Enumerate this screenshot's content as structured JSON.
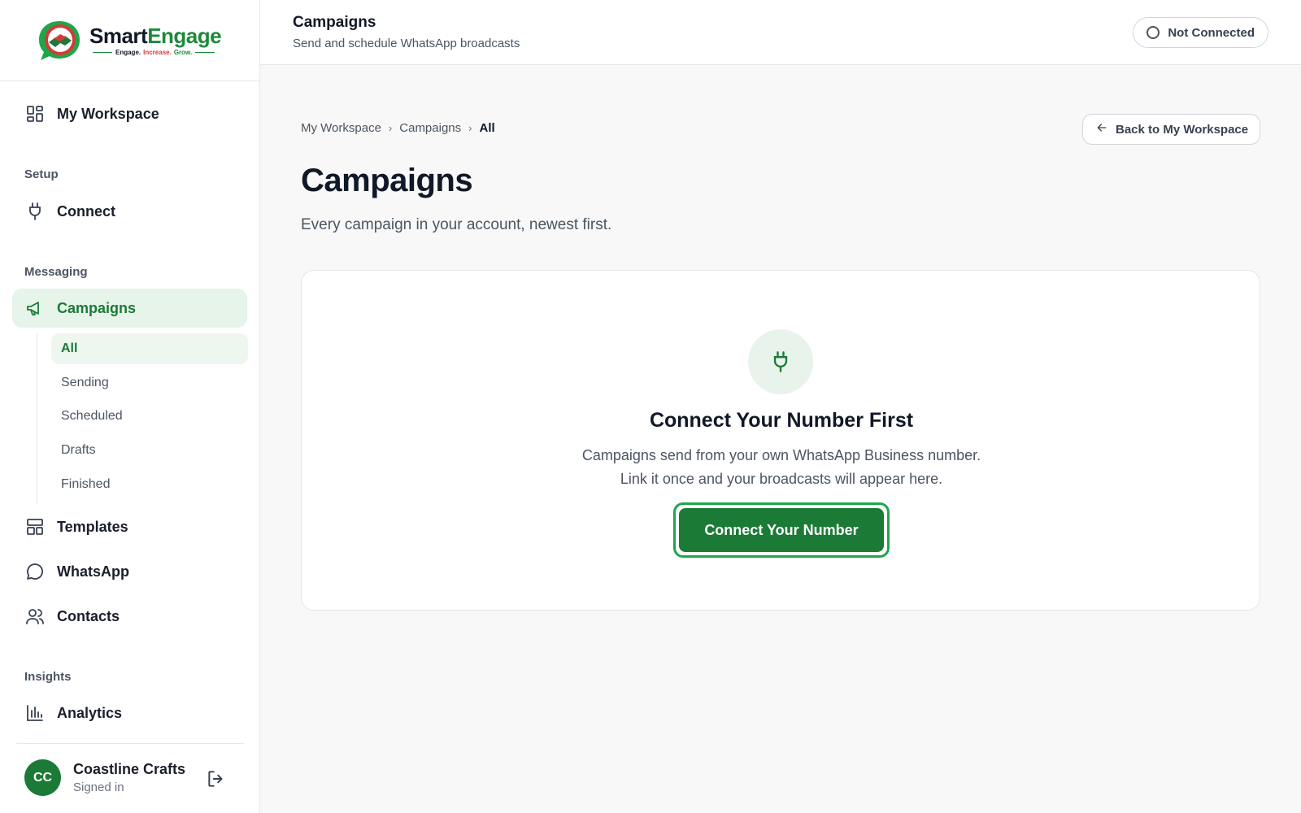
{
  "brand": {
    "name_part1": "Smart",
    "name_part2": "Engage",
    "tagline_1": "Engage.",
    "tagline_2": "Increase.",
    "tagline_3": "Grow.",
    "colors": {
      "primary": "#1b7a36",
      "accent_red": "#d33a3a"
    }
  },
  "sidebar": {
    "workspace": {
      "label": "My Workspace",
      "icon": "dashboard-icon"
    },
    "sections": {
      "setup": "Setup",
      "messaging": "Messaging",
      "insights": "Insights"
    },
    "connect": {
      "label": "Connect",
      "icon": "plug-icon"
    },
    "campaigns": {
      "label": "Campaigns",
      "icon": "megaphone-icon"
    },
    "campaign_subnav": [
      {
        "label": "All",
        "active": true
      },
      {
        "label": "Sending"
      },
      {
        "label": "Scheduled"
      },
      {
        "label": "Drafts"
      },
      {
        "label": "Finished"
      }
    ],
    "templates": {
      "label": "Templates",
      "icon": "template-icon"
    },
    "whatsapp": {
      "label": "WhatsApp",
      "icon": "chat-bubble-icon"
    },
    "contacts": {
      "label": "Contacts",
      "icon": "users-icon"
    },
    "analytics": {
      "label": "Analytics",
      "icon": "bar-chart-icon"
    },
    "user": {
      "initials": "CC",
      "name": "Coastline Crafts",
      "status": "Signed in"
    }
  },
  "header": {
    "title": "Campaigns",
    "subtitle": "Send and schedule WhatsApp broadcasts",
    "connection_status": "Not Connected"
  },
  "main": {
    "breadcrumb": [
      "My Workspace",
      "Campaigns",
      "All"
    ],
    "back_button": "Back to My Workspace",
    "title": "Campaigns",
    "subtitle": "Every campaign in your account, newest first.",
    "empty_state": {
      "title": "Connect Your Number First",
      "line1": "Campaigns send from your own WhatsApp Business number.",
      "line2": "Link it once and your broadcasts will appear here.",
      "cta": "Connect Your Number"
    }
  }
}
